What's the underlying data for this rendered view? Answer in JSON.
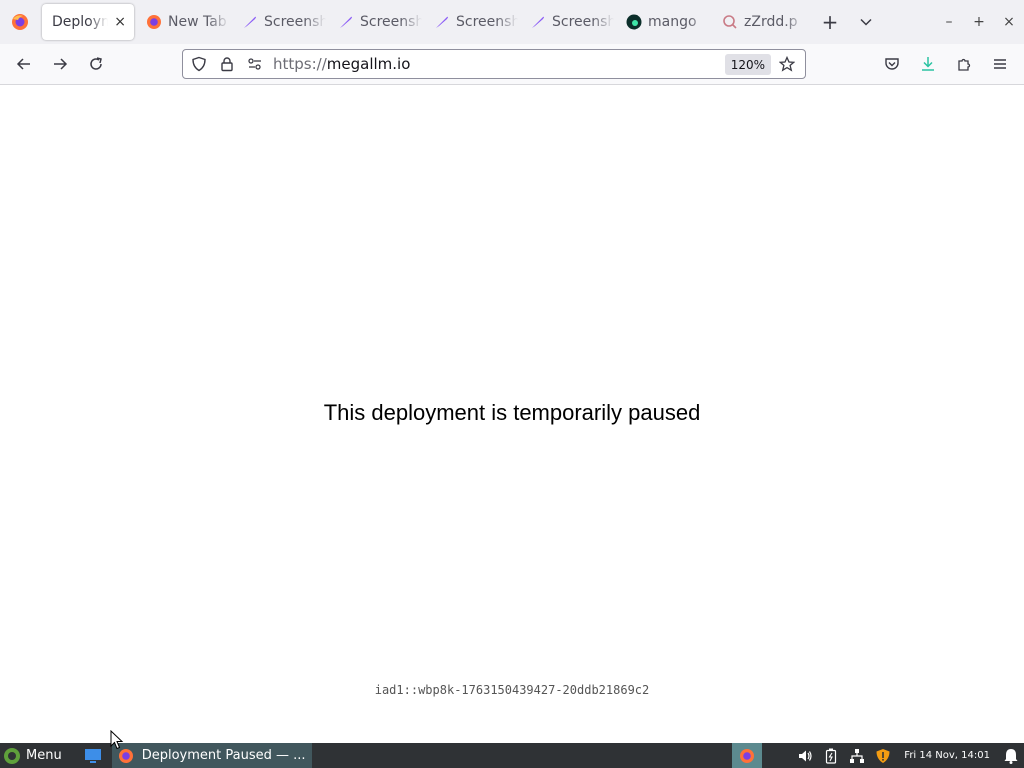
{
  "browser": {
    "tabs": [
      {
        "label": "Deployment Paused",
        "icon": "firefox-icon",
        "active": true
      },
      {
        "label": "New Tab",
        "icon": "firefox-icon"
      },
      {
        "label": "Screenshot",
        "icon": "feather-icon"
      },
      {
        "label": "Screenshot",
        "icon": "feather-icon"
      },
      {
        "label": "Screenshot",
        "icon": "feather-icon"
      },
      {
        "label": "Screenshot",
        "icon": "feather-icon"
      },
      {
        "label": "mango",
        "icon": "mango-icon"
      },
      {
        "label": "zZrdd.p",
        "icon": "search-icon"
      }
    ],
    "close_glyph": "×",
    "new_tab_glyph": "+",
    "tab_list_glyph": "⌄",
    "window_controls": {
      "minimize": "–",
      "maximize": "+",
      "close": "×"
    },
    "url": {
      "scheme": "https://",
      "host": "megallm.io"
    },
    "zoom": "120%",
    "accent_colors": {
      "download": "#2ac3a2",
      "firefox_orange": "#ff7139",
      "feather_purple": "#8b5cf6"
    }
  },
  "page": {
    "message": "This deployment is temporarily paused",
    "deployment_id": "iad1::wbp8k-1763150439427-20ddb21869c2"
  },
  "taskbar": {
    "menu_label": "Menu",
    "active_window": "Deployment Paused — ...",
    "clock": "Fri 14 Nov, 14:01"
  }
}
